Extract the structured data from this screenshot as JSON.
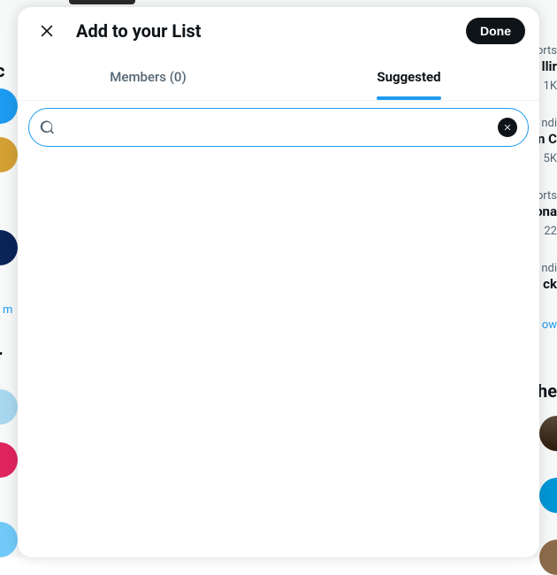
{
  "modal": {
    "title": "Add to your List",
    "done_label": "Done",
    "tabs": {
      "members": "Members (0)",
      "suggested": "Suggested"
    },
    "search": {
      "placeholder": ""
    }
  },
  "background": {
    "left_link": "m",
    "heading_c": "c",
    "heading_r": "r",
    "right_items": [
      {
        "category": "orts",
        "title": "llir",
        "stat": "1K"
      },
      {
        "category": "ndi",
        "title": "n C",
        "stat": "5K"
      },
      {
        "category": "orts",
        "title": "ona",
        "stat": "22"
      },
      {
        "category": "ndi",
        "title": "ck",
        "link": "ow"
      }
    ],
    "right_heading": "The"
  }
}
